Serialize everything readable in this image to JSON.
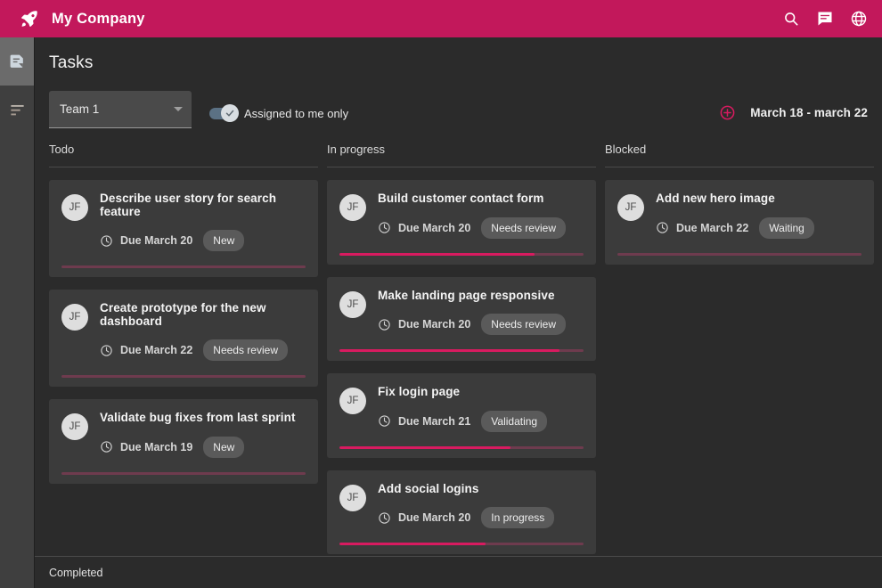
{
  "topbar": {
    "brand_title": "My Company",
    "logo_icon": "rocket-icon",
    "actions": [
      {
        "icon": "search-icon",
        "name": "search-button"
      },
      {
        "icon": "chat-icon",
        "name": "messages-button"
      },
      {
        "icon": "globe-icon",
        "name": "language-button"
      }
    ]
  },
  "sidebar": {
    "items": [
      {
        "icon": "tasks-icon",
        "name": "sidebar-item-tasks",
        "active": true
      },
      {
        "icon": "list-icon",
        "name": "sidebar-item-list",
        "active": false
      }
    ]
  },
  "page": {
    "title": "Tasks"
  },
  "toolbar": {
    "team_select": {
      "value": "Team 1",
      "options": [
        "Team 1"
      ]
    },
    "assigned_toggle": {
      "label": "Assigned to me only",
      "checked": true
    },
    "add_icon": "add-circle-icon",
    "date_range": "March 18 - march 22"
  },
  "board": {
    "columns": [
      {
        "title": "Todo",
        "cards": [
          {
            "avatar": "JF",
            "title": "Describe user story for search feature",
            "due": "Due March 20",
            "badge": "New",
            "progress": 0
          },
          {
            "avatar": "JF",
            "title": "Create prototype for the new dashboard",
            "due": "Due March 22",
            "badge": "Needs review",
            "progress": 0
          },
          {
            "avatar": "JF",
            "title": "Validate bug fixes from last sprint",
            "due": "Due March 19",
            "badge": "New",
            "progress": 0
          }
        ]
      },
      {
        "title": "In progress",
        "cards": [
          {
            "avatar": "JF",
            "title": "Build customer contact form",
            "due": "Due March 20",
            "badge": "Needs review",
            "progress": 80
          },
          {
            "avatar": "JF",
            "title": "Make landing page responsive",
            "due": "Due March 20",
            "badge": "Needs review",
            "progress": 90
          },
          {
            "avatar": "JF",
            "title": "Fix login page",
            "due": "Due March 21",
            "badge": "Validating",
            "progress": 70
          },
          {
            "avatar": "JF",
            "title": "Add social logins",
            "due": "Due March 20",
            "badge": "In progress",
            "progress": 60
          }
        ]
      },
      {
        "title": "Blocked",
        "cards": [
          {
            "avatar": "JF",
            "title": "Add new hero image",
            "due": "Due March 22",
            "badge": "Waiting",
            "progress": 0
          }
        ]
      }
    ]
  },
  "footer": {
    "completed_label": "Completed"
  },
  "colors": {
    "brand": "#c2185b",
    "accent": "#d81b60",
    "page_bg": "#2b2b2b",
    "card_bg": "#3b3b3b",
    "rail_bg": "#3f3f3f",
    "progress_track": "#6e3b4e"
  }
}
